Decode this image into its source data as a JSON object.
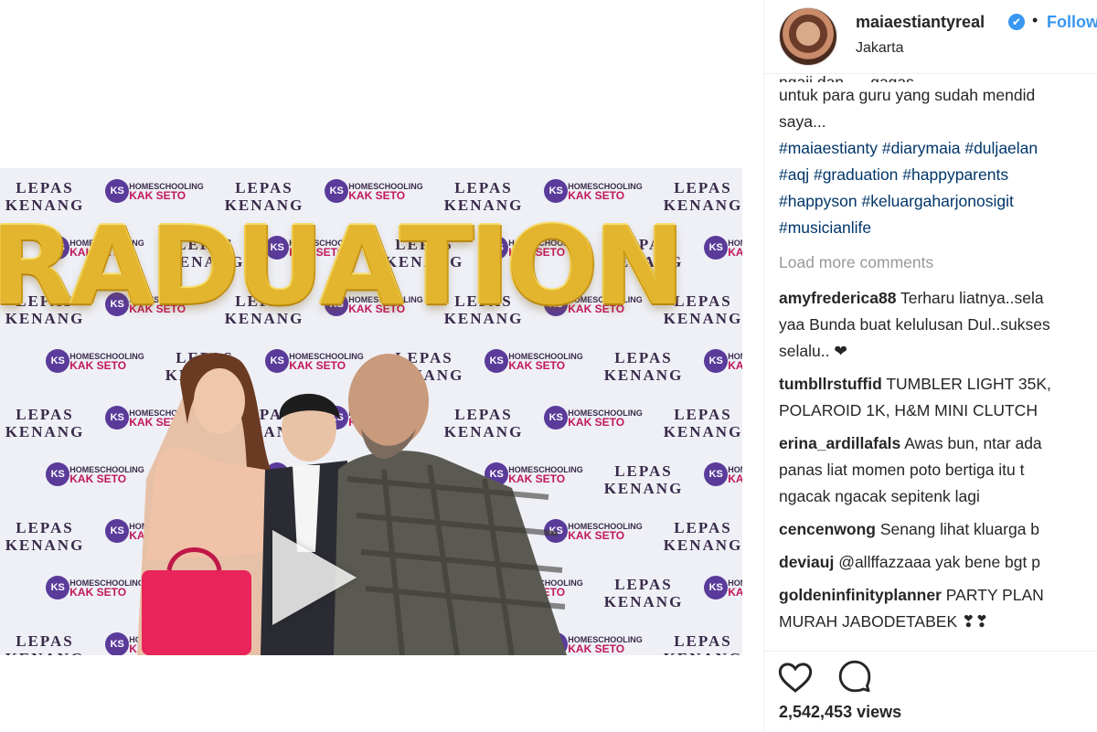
{
  "post": {
    "username": "maiaestiantyreal",
    "location": "Jakarta",
    "follow_label": "Follow",
    "separator": "•",
    "verified_glyph": "✔"
  },
  "media": {
    "balloon_letters": [
      "R",
      "A",
      "D",
      "U",
      "A",
      "T",
      "I",
      "O",
      "N"
    ],
    "backdrop_brand_1": "LEPAS",
    "backdrop_brand_1b": "KENANG",
    "backdrop_brand_2_badge": "KS",
    "backdrop_brand_2_line1": "HOMESCHOOLING",
    "backdrop_brand_2_line2": "KAK SETO",
    "play_icon": "play-icon"
  },
  "caption": {
    "cut_line": "ngaji dan .... gagas.......... .. ......",
    "lines": [
      "untuk para guru yang sudah mendid",
      "saya..."
    ],
    "hashtag_lines": [
      [
        "#maiaestianty",
        "#diarymaia",
        "#duljaelan"
      ],
      [
        "#aqj",
        "#graduation",
        "#happyparents"
      ],
      [
        "#happyson",
        "#keluargaharjonosigit"
      ],
      [
        "#musicianlife"
      ]
    ]
  },
  "load_more": "Load more comments",
  "comments": [
    {
      "user": "amyfrederica88",
      "lines": [
        "Terharu liatnya..sela",
        "yaa Bunda buat kelulusan Dul..sukses",
        "selalu.. ❤"
      ]
    },
    {
      "user": "tumbllrstuffid",
      "lines": [
        "TUMBLER LIGHT 35K,",
        "POLAROID 1K, H&M MINI CLUTCH"
      ]
    },
    {
      "user": "erina_ardillafals",
      "lines": [
        "Awas bun, ntar ada",
        "panas liat momen poto bertiga itu t",
        "ngacak ngacak sepitenk lagi"
      ]
    },
    {
      "user": "cencenwong",
      "lines": [
        "Senang lihat kluarga b"
      ]
    },
    {
      "user": "deviauj",
      "lines": [
        "@allffazzaaa yak bene bgt p"
      ]
    },
    {
      "user": "goldeninfinityplanner",
      "lines": [
        "PARTY PLAN",
        "MURAH JABODETABEK ❣❣"
      ]
    }
  ],
  "actions": {
    "like_icon": "heart-icon",
    "comment_icon": "comment-icon",
    "views": "2,542,453 views"
  },
  "colors": {
    "link_blue": "#3897f0",
    "hashtag_blue": "#003569",
    "muted_gray": "#999999",
    "balloon_gold": "#e3b52e"
  }
}
